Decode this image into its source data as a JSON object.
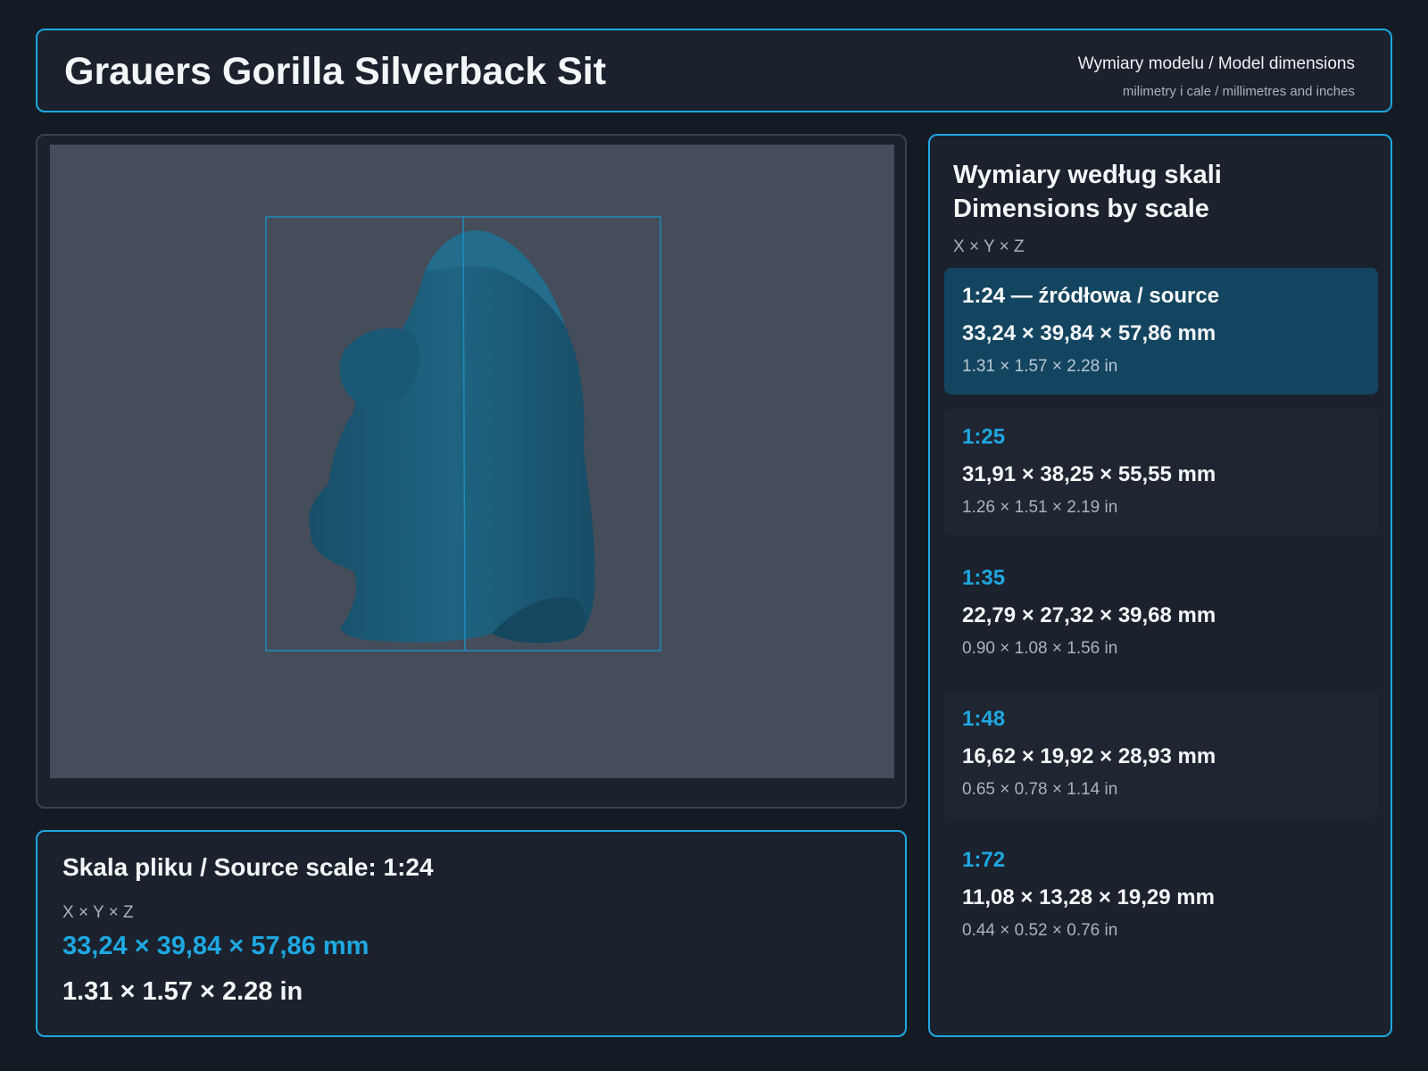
{
  "header": {
    "title": "Grauers Gorilla Silverback Sit",
    "subtitle": "Wymiary modelu / Model dimensions",
    "units_note": "milimetry i cale / millimetres and inches"
  },
  "viewer": {
    "model_icon": "gorilla-model-icon"
  },
  "source": {
    "title": "Skala pliku / Source scale: 1:24",
    "axes": "X × Y × Z",
    "mm": "33,24 × 39,84 × 57,86 mm",
    "inches": "1.31 × 1.57 × 2.28 in"
  },
  "scales_panel": {
    "title_pl": "Wymiary według skali",
    "title_en": "Dimensions by scale",
    "axes": "X × Y × Z",
    "rows": [
      {
        "scale": "1:24  —  źródłowa / source",
        "mm": "33,24 × 39,84 × 57,86 mm",
        "inches": "1.31 × 1.57 × 2.28 in"
      },
      {
        "scale": "1:25",
        "mm": "31,91 × 38,25 × 55,55 mm",
        "inches": "1.26 × 1.51 × 2.19 in"
      },
      {
        "scale": "1:35",
        "mm": "22,79 × 27,32 × 39,68 mm",
        "inches": "0.90 × 1.08 × 1.56 in"
      },
      {
        "scale": "1:48",
        "mm": "16,62 × 19,92 × 28,93 mm",
        "inches": "0.65 × 0.78 × 1.14 in"
      },
      {
        "scale": "1:72",
        "mm": "11,08 × 13,28 × 19,29 mm",
        "inches": "0.44 × 0.52 × 0.76 in"
      }
    ]
  },
  "colors": {
    "accent": "#1ea7e1",
    "background": "#141b25",
    "panel": "#1b222d",
    "selected_row": "#144560",
    "model": "#1d5f7d"
  }
}
